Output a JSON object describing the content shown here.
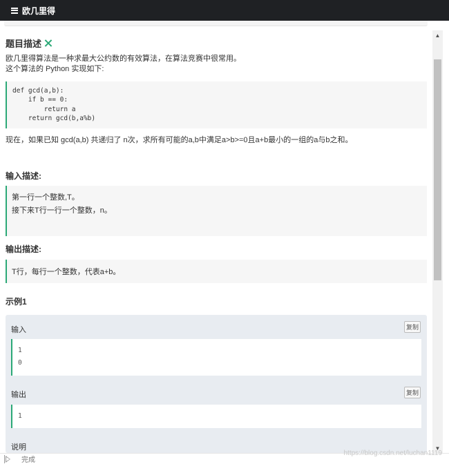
{
  "header": {
    "title": "欧几里得",
    "icon": "list-icon"
  },
  "problem": {
    "heading": "题目描述",
    "expand_icon": "expand-icon",
    "line1": "欧几里得算法是一种求最大公约数的有效算法，在算法竞赛中很常用。",
    "line2": "这个算法的 Python 实现如下:",
    "code": "def gcd(a,b):\n    if b == 0:\n        return a\n    return gcd(b,a%b)",
    "line3": "现在，如果已知 gcd(a,b) 共递归了 n次，求所有可能的a,b中满足a>b>=0且a+b最小的一组的a与b之和。"
  },
  "input_section": {
    "heading": "输入描述:",
    "lines": [
      "第一行一个整数,T。",
      "接下来T行一行一个整数，n。"
    ]
  },
  "output_section": {
    "heading": "输出描述:",
    "text": "T行，每行一个整数，代表a+b。"
  },
  "example": {
    "heading": "示例1",
    "input_label": "输入",
    "input_lines": [
      "1",
      "0"
    ],
    "output_label": "输出",
    "output_lines": [
      "1"
    ],
    "explain_label": "说明",
    "copy_label": "复制"
  },
  "footer": {
    "status": "完成",
    "watermark": "https://blog.csdn.net/luchan1119"
  },
  "colors": {
    "accent": "#2aa876",
    "topbar": "#1f2124"
  }
}
